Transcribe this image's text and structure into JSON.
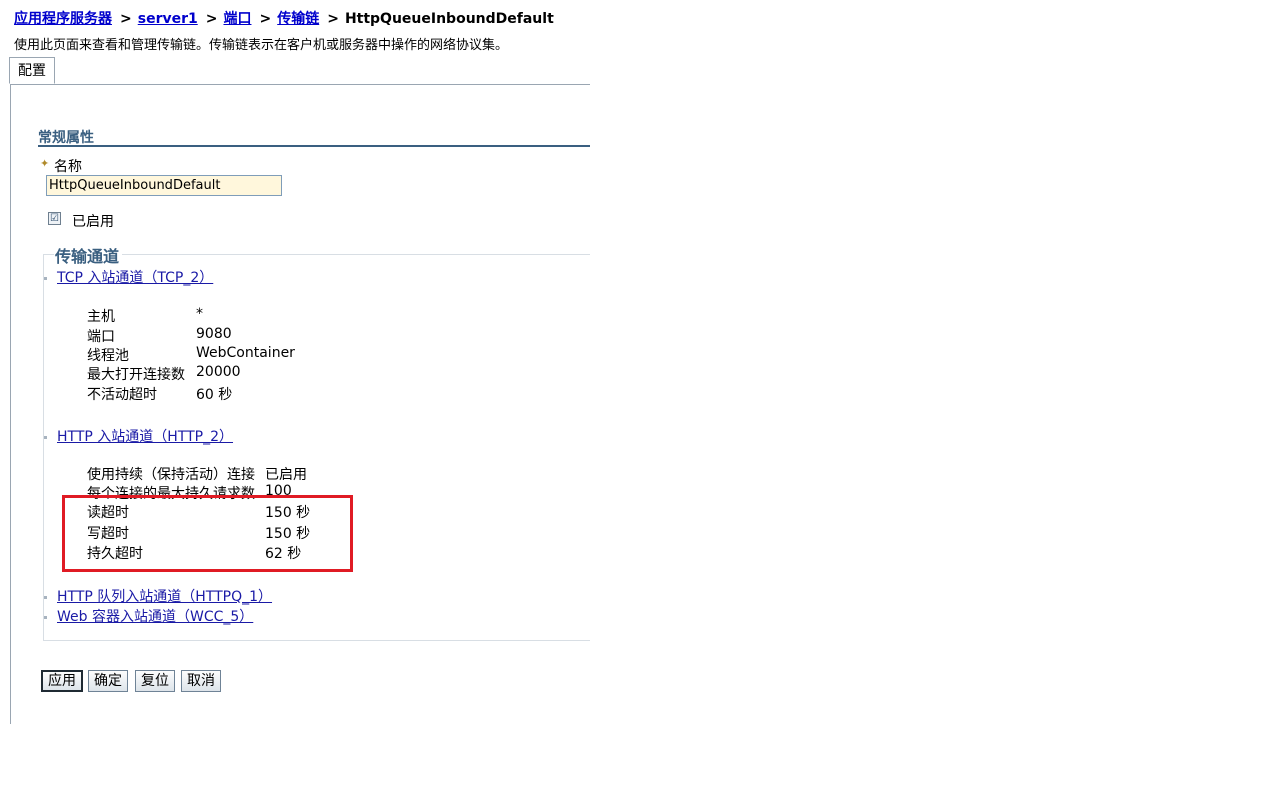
{
  "breadcrumb": {
    "items": [
      "应用程序服务器",
      "server1",
      "端口",
      "传输链"
    ],
    "separator": ">",
    "current": "HttpQueueInboundDefault"
  },
  "description": "使用此页面来查看和管理传输链。传输链表示在客户机或服务器中操作的网络协议集。",
  "tabs": [
    "配置"
  ],
  "general": {
    "title": "常规属性",
    "name_label": "名称",
    "name_value": "HttpQueueInboundDefault",
    "enabled_label": "已启用",
    "enabled_checked": "☑"
  },
  "transport": {
    "legend": "传输通道",
    "tcp": {
      "link": "TCP 入站通道（TCP_2）",
      "props": [
        {
          "label": "主机",
          "value": "*"
        },
        {
          "label": "端口",
          "value": "9080"
        },
        {
          "label": "线程池",
          "value": "WebContainer"
        },
        {
          "label": "最大打开连接数",
          "value": "20000"
        },
        {
          "label": "不活动超时",
          "value": "60 秒"
        }
      ]
    },
    "http": {
      "link": "HTTP 入站通道（HTTP_2）",
      "props": [
        {
          "label": "使用持续（保持活动）连接",
          "value": "已启用"
        },
        {
          "label": "每个连接的最大持久请求数",
          "value": "100"
        },
        {
          "label": "读超时",
          "value": "150 秒"
        },
        {
          "label": "写超时",
          "value": "150 秒"
        },
        {
          "label": "持久超时",
          "value": "62 秒"
        }
      ]
    },
    "httpq_link": "HTTP 队列入站通道（HTTPQ_1）",
    "wcc_link": "Web 容器入站通道（WCC_5）"
  },
  "buttons": {
    "apply": "应用",
    "ok": "确定",
    "reset": "复位",
    "cancel": "取消"
  },
  "colors": {
    "link": "#0000cc",
    "section": "#3a5f80",
    "highlight": "#e01b24",
    "input_bg": "#fff7dc"
  }
}
